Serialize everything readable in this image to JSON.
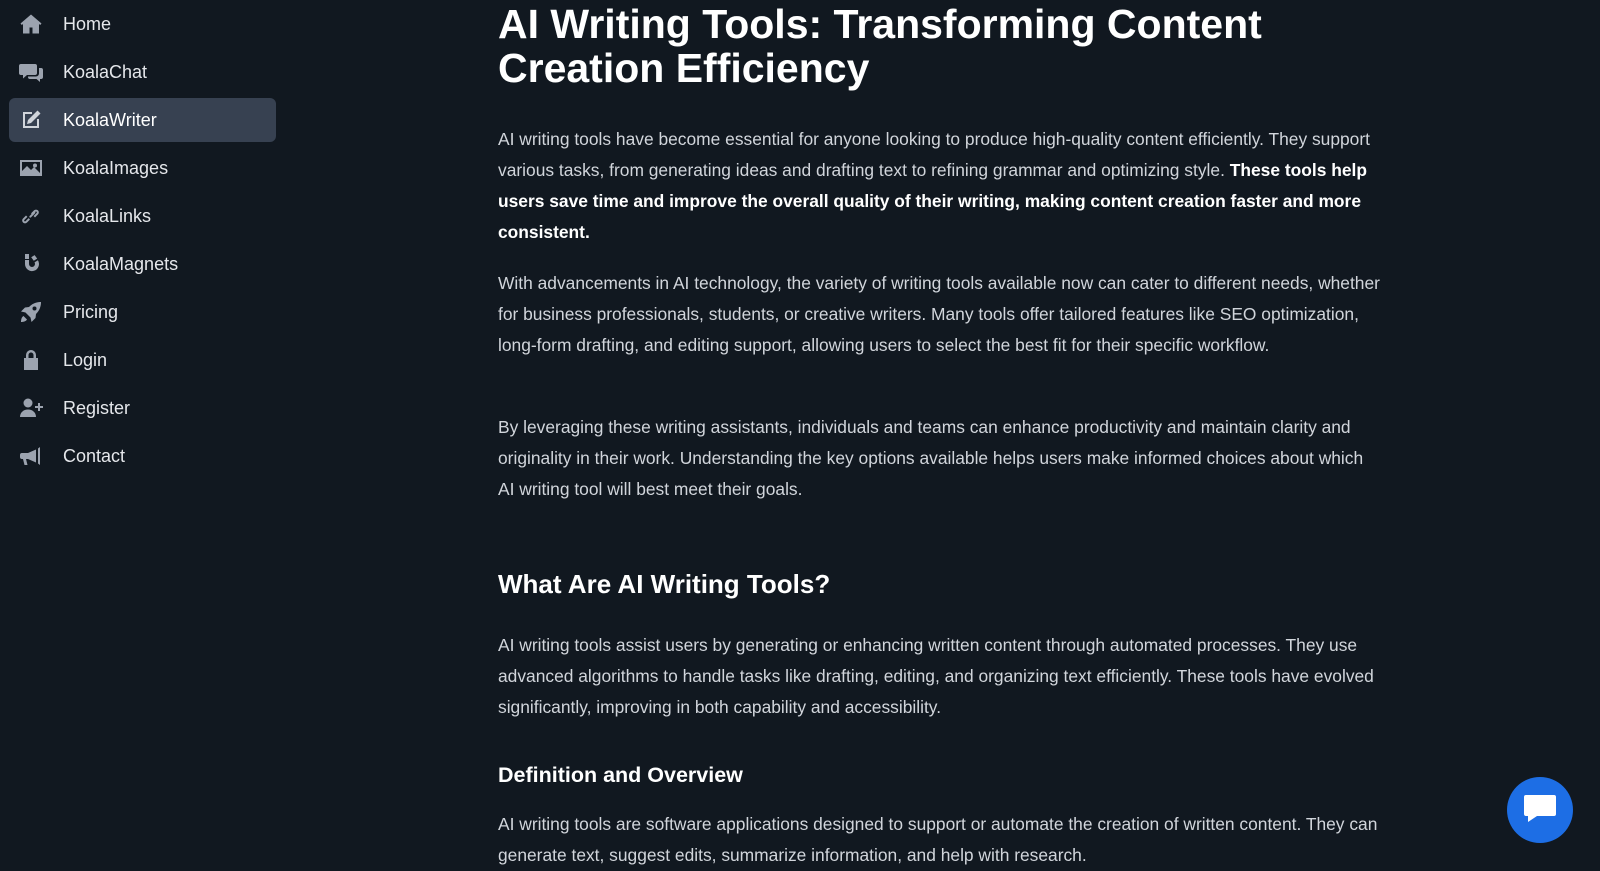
{
  "sidebar": {
    "items": [
      {
        "label": "Home",
        "icon": "home-icon"
      },
      {
        "label": "KoalaChat",
        "icon": "chat-bubbles-icon"
      },
      {
        "label": "KoalaWriter",
        "icon": "edit-icon",
        "active": true
      },
      {
        "label": "KoalaImages",
        "icon": "image-icon"
      },
      {
        "label": "KoalaLinks",
        "icon": "link-icon"
      },
      {
        "label": "KoalaMagnets",
        "icon": "magnet-icon"
      },
      {
        "label": "Pricing",
        "icon": "rocket-icon"
      },
      {
        "label": "Login",
        "icon": "lock-icon"
      },
      {
        "label": "Register",
        "icon": "user-plus-icon"
      },
      {
        "label": "Contact",
        "icon": "megaphone-icon"
      }
    ]
  },
  "article": {
    "title": "AI Writing Tools: Transforming Content Creation Efficiency",
    "intro_p1_normal": "AI writing tools have become essential for anyone looking to produce high-quality content efficiently. They support various tasks, from generating ideas and drafting text to refining grammar and optimizing style. ",
    "intro_p1_bold": "These tools help users save time and improve the overall quality of their writing, making content creation faster and more consistent.",
    "intro_p2": "With advancements in AI technology, the variety of writing tools available now can cater to different needs, whether for business professionals, students, or creative writers. Many tools offer tailored features like SEO optimization, long-form drafting, and editing support, allowing users to select the best fit for their specific workflow.",
    "intro_p3": "By leveraging these writing assistants, individuals and teams can enhance productivity and maintain clarity and originality in their work. Understanding the key options available helps users make informed choices about which AI writing tool will best meet their goals.",
    "section_heading": "What Are AI Writing Tools?",
    "section_p1": "AI writing tools assist users by generating or enhancing written content through automated processes. They use advanced algorithms to handle tasks like drafting, editing, and organizing text efficiently. These tools have evolved significantly, improving in both capability and accessibility.",
    "subsection_heading": "Definition and Overview",
    "subsection_p1": "AI writing tools are software applications designed to support or automate the creation of written content. They can generate text, suggest edits, summarize information, and help with research."
  },
  "chat_widget": {
    "icon": "chat-bubble-icon",
    "color": "#1d6ee5"
  },
  "colors": {
    "background": "#111820",
    "active_item": "#374151",
    "accent": "#1d6ee5"
  }
}
